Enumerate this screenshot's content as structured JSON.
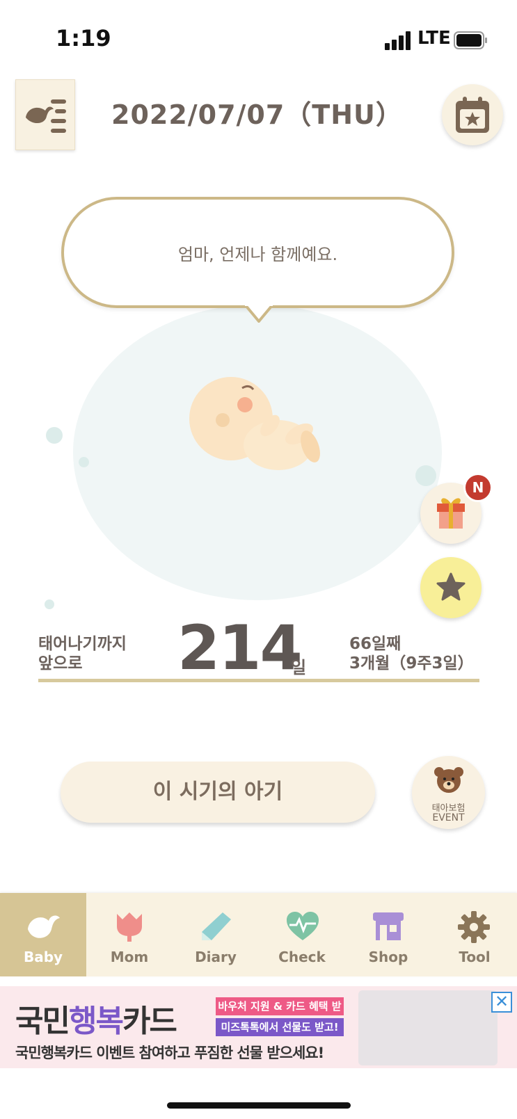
{
  "status": {
    "time": "1:19",
    "network": "LTE"
  },
  "header": {
    "date": "2022/07/07（THU）",
    "menu_icon": "bird-list-icon",
    "calendar_icon": "calendar-star-icon"
  },
  "bubble": {
    "text": "엄마, 언제나 함께예요."
  },
  "gift": {
    "badge": "N"
  },
  "countdown": {
    "label_line1": "태어나기까지",
    "label_line2": "앞으로",
    "days": "214",
    "unit": "일",
    "day_number": "66일째",
    "month_week": "3개월（9주3일）"
  },
  "cta": {
    "label": "이 시기의 아기"
  },
  "event": {
    "line1": "태아보험",
    "line2": "EVENT"
  },
  "tabs": [
    {
      "label": "Baby",
      "icon": "bird-icon",
      "active": true
    },
    {
      "label": "Mom",
      "icon": "tulip-icon",
      "active": false
    },
    {
      "label": "Diary",
      "icon": "pencil-icon",
      "active": false
    },
    {
      "label": "Check",
      "icon": "heartbeat-icon",
      "active": false
    },
    {
      "label": "Shop",
      "icon": "store-icon",
      "active": false
    },
    {
      "label": "Tool",
      "icon": "gear-icon",
      "active": false
    }
  ],
  "ad": {
    "title_a": "국민",
    "title_b": "행복",
    "title_c": "카드",
    "tag1": "바우처 지원 & 카드 혜택 받고",
    "tag2": "미즈톡톡에서 선물도 받고!",
    "subtitle": "국민행복카드 이벤트 참여하고 푸짐한 선물 받으세요!",
    "close": "✕"
  },
  "colors": {
    "accent": "#d6c595",
    "tab_bg": "#f9f2e1",
    "badge": "#c33a2f",
    "star_bg": "#f8ef98"
  }
}
